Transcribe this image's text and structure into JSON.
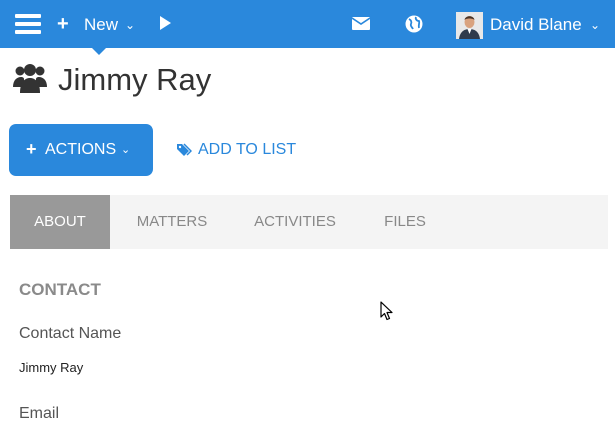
{
  "topbar": {
    "new_label": "New",
    "user_name": "David Blane",
    "icons": [
      "menu-icon",
      "plus-icon",
      "chevron-down-icon",
      "play-icon",
      "mail-icon",
      "globe-icon",
      "avatar",
      "chevron-down-icon"
    ],
    "color": "#2a88dc"
  },
  "page": {
    "title": "Jimmy Ray",
    "title_icon": "users-icon"
  },
  "toolbar": {
    "actions_label": "ACTIONS",
    "add_to_list_label": "ADD TO LIST"
  },
  "tabs": [
    {
      "label": "ABOUT",
      "active": true
    },
    {
      "label": "MATTERS",
      "active": false
    },
    {
      "label": "ACTIVITIES",
      "active": false
    },
    {
      "label": "FILES",
      "active": false
    }
  ],
  "contact": {
    "section_title": "CONTACT",
    "name_label": "Contact Name",
    "name_value": "Jimmy Ray",
    "email_label": "Email"
  }
}
